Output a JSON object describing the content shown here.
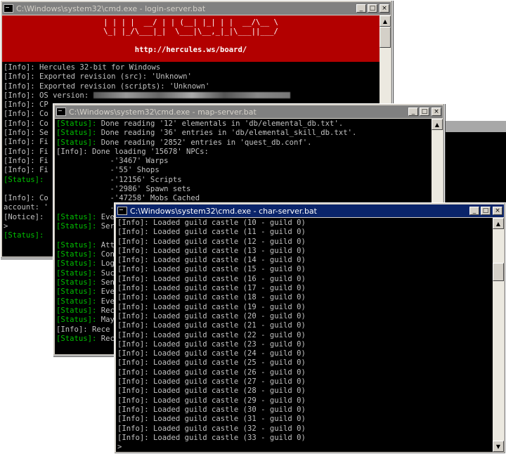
{
  "windows": {
    "login": {
      "title": "C:\\Windows\\system32\\cmd.exe - login-server.bat",
      "banner": [
        "| | | |  __/ | | (__| |_| | |  __/\\__ \\",
        "\\_| |_/\\___|_|  \\___|\\__,_|_|\\___||___/",
        "",
        "http://hercules.ws/board/"
      ],
      "lines": [
        {
          "tag": "[Info]:",
          "text": " Hercules 32-bit for Windows"
        },
        {
          "tag": "[Info]:",
          "text": " Exported revision (src): 'Unknown'"
        },
        {
          "tag": "[Info]:",
          "text": " Exported revision (scripts): 'Unknown'"
        },
        {
          "tag": "[Info]:",
          "text": " OS version: "
        },
        {
          "tag": "[Info]:",
          "text": " CP"
        },
        {
          "tag": "[Info]:",
          "text": " Co"
        },
        {
          "tag": "[Info]:",
          "text": " Co"
        },
        {
          "tag": "[Info]:",
          "text": " Se"
        },
        {
          "tag": "[Info]:",
          "text": " Fi"
        },
        {
          "tag": "[Info]:",
          "text": " Fi"
        },
        {
          "tag": "[Info]:",
          "text": " Fi"
        },
        {
          "tag": "[Info]:",
          "text": " Fi"
        },
        {
          "tag": "[Status]:",
          "text": " "
        },
        {
          "tag": "",
          "text": ""
        },
        {
          "tag": "[Info]:",
          "text": " Co"
        },
        {
          "tag": "",
          "text": "account: '"
        },
        {
          "tag": "[Notice]:",
          "text": " "
        },
        {
          "tag": "",
          "text": ">"
        },
        {
          "tag": "[Status]:",
          "text": ""
        }
      ]
    },
    "map": {
      "title": "C:\\Windows\\system32\\cmd.exe - map-server.bat",
      "lines": [
        {
          "tag": "[Status]:",
          "text": " Done reading '12' elementals in 'db/elemental_db.txt'."
        },
        {
          "tag": "[Status]:",
          "text": " Done reading '36' entries in 'db/elemental_skill_db.txt'."
        },
        {
          "tag": "[Status]:",
          "text": " Done reading '2852' entries in 'quest_db.conf'."
        },
        {
          "tag": "[Info]:",
          "text": " Done loading '15678' NPCs:"
        },
        {
          "tag": "",
          "text": "            -'3467' Warps"
        },
        {
          "tag": "",
          "text": "            -'55' Shops"
        },
        {
          "tag": "",
          "text": "            -'12156' Scripts"
        },
        {
          "tag": "",
          "text": "            -'2986' Spawn sets"
        },
        {
          "tag": "",
          "text": "            -'47258' Mobs Cached"
        },
        {
          "tag": "",
          "text": "            -'0'"
        },
        {
          "tag": "[Status]:",
          "text": " Eve"
        },
        {
          "tag": "[Status]:",
          "text": " Ser"
        },
        {
          "tag": "",
          "text": ""
        },
        {
          "tag": "[Status]:",
          "text": " Att"
        },
        {
          "tag": "[Status]:",
          "text": " Con"
        },
        {
          "tag": "[Status]:",
          "text": " Log"
        },
        {
          "tag": "[Status]:",
          "text": " Suc"
        },
        {
          "tag": "[Status]:",
          "text": " Sen"
        },
        {
          "tag": "[Status]:",
          "text": " Eve"
        },
        {
          "tag": "[Status]:",
          "text": " Eve"
        },
        {
          "tag": "[Status]:",
          "text": " Rec"
        },
        {
          "tag": "[Status]:",
          "text": " May"
        },
        {
          "tag": "[Info]:",
          "text": " Rece"
        },
        {
          "tag": "[Status]:",
          "text": " Rec"
        }
      ]
    },
    "char": {
      "title": "C:\\Windows\\system32\\cmd.exe - char-server.bat",
      "lines": [
        {
          "tag": "[Info]:",
          "text": " Loaded guild castle (10 - guild 0)"
        },
        {
          "tag": "[Info]:",
          "text": " Loaded guild castle (11 - guild 0)"
        },
        {
          "tag": "[Info]:",
          "text": " Loaded guild castle (12 - guild 0)"
        },
        {
          "tag": "[Info]:",
          "text": " Loaded guild castle (13 - guild 0)"
        },
        {
          "tag": "[Info]:",
          "text": " Loaded guild castle (14 - guild 0)"
        },
        {
          "tag": "[Info]:",
          "text": " Loaded guild castle (15 - guild 0)"
        },
        {
          "tag": "[Info]:",
          "text": " Loaded guild castle (16 - guild 0)"
        },
        {
          "tag": "[Info]:",
          "text": " Loaded guild castle (17 - guild 0)"
        },
        {
          "tag": "[Info]:",
          "text": " Loaded guild castle (18 - guild 0)"
        },
        {
          "tag": "[Info]:",
          "text": " Loaded guild castle (19 - guild 0)"
        },
        {
          "tag": "[Info]:",
          "text": " Loaded guild castle (20 - guild 0)"
        },
        {
          "tag": "[Info]:",
          "text": " Loaded guild castle (21 - guild 0)"
        },
        {
          "tag": "[Info]:",
          "text": " Loaded guild castle (22 - guild 0)"
        },
        {
          "tag": "[Info]:",
          "text": " Loaded guild castle (23 - guild 0)"
        },
        {
          "tag": "[Info]:",
          "text": " Loaded guild castle (24 - guild 0)"
        },
        {
          "tag": "[Info]:",
          "text": " Loaded guild castle (25 - guild 0)"
        },
        {
          "tag": "[Info]:",
          "text": " Loaded guild castle (26 - guild 0)"
        },
        {
          "tag": "[Info]:",
          "text": " Loaded guild castle (27 - guild 0)"
        },
        {
          "tag": "[Info]:",
          "text": " Loaded guild castle (28 - guild 0)"
        },
        {
          "tag": "[Info]:",
          "text": " Loaded guild castle (29 - guild 0)"
        },
        {
          "tag": "[Info]:",
          "text": " Loaded guild castle (30 - guild 0)"
        },
        {
          "tag": "[Info]:",
          "text": " Loaded guild castle (31 - guild 0)"
        },
        {
          "tag": "[Info]:",
          "text": " Loaded guild castle (32 - guild 0)"
        },
        {
          "tag": "[Info]:",
          "text": " Loaded guild castle (33 - guild 0)"
        },
        {
          "tag": "",
          "text": ">"
        }
      ]
    }
  },
  "window_buttons": {
    "minimize": "_",
    "maximize": "□",
    "close": "×"
  },
  "scroll_arrows": {
    "up": "▲",
    "down": "▼"
  },
  "icons": {
    "window": "cmd-icon",
    "minimize": "minimize-icon",
    "maximize": "maximize-icon",
    "close": "close-icon"
  },
  "colors": {
    "status_tag": "#00c000",
    "text": "#c0c0c0",
    "banner_bg": "#b20000",
    "active_title": "#0a246a",
    "inactive_title": "#808080"
  }
}
